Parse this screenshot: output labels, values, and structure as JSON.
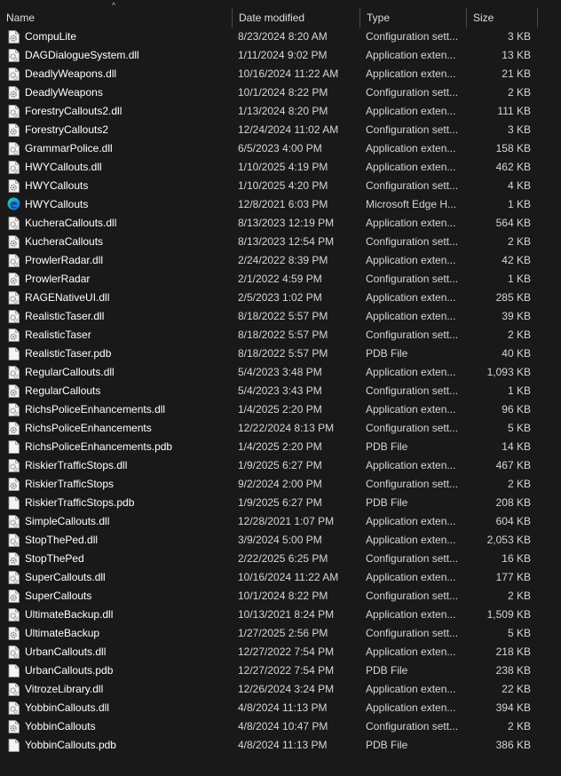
{
  "header": {
    "name": "Name",
    "date": "Date modified",
    "type": "Type",
    "size": "Size",
    "sort_arrow": "^"
  },
  "files": [
    {
      "name": "CompuLite",
      "date": "8/23/2024 8:20 AM",
      "type": "Configuration sett...",
      "size": "3 KB",
      "icon": "config-file-icon"
    },
    {
      "name": "DAGDialogueSystem.dll",
      "date": "1/11/2024 9:02 PM",
      "type": "Application exten...",
      "size": "13 KB",
      "icon": "dll-file-icon"
    },
    {
      "name": "DeadlyWeapons.dll",
      "date": "10/16/2024 11:22 AM",
      "type": "Application exten...",
      "size": "21 KB",
      "icon": "dll-file-icon"
    },
    {
      "name": "DeadlyWeapons",
      "date": "10/1/2024 8:22 PM",
      "type": "Configuration sett...",
      "size": "2 KB",
      "icon": "config-file-icon"
    },
    {
      "name": "ForestryCallouts2.dll",
      "date": "1/13/2024 8:20 PM",
      "type": "Application exten...",
      "size": "111 KB",
      "icon": "dll-file-icon"
    },
    {
      "name": "ForestryCallouts2",
      "date": "12/24/2024 11:02 AM",
      "type": "Configuration sett...",
      "size": "3 KB",
      "icon": "config-file-icon"
    },
    {
      "name": "GrammarPolice.dll",
      "date": "6/5/2023 4:00 PM",
      "type": "Application exten...",
      "size": "158 KB",
      "icon": "dll-file-icon"
    },
    {
      "name": "HWYCallouts.dll",
      "date": "1/10/2025 4:19 PM",
      "type": "Application exten...",
      "size": "462 KB",
      "icon": "dll-file-icon"
    },
    {
      "name": "HWYCallouts",
      "date": "1/10/2025 4:20 PM",
      "type": "Configuration sett...",
      "size": "4 KB",
      "icon": "config-file-icon"
    },
    {
      "name": "HWYCallouts",
      "date": "12/8/2021 6:03 PM",
      "type": "Microsoft Edge H...",
      "size": "1 KB",
      "icon": "edge-icon"
    },
    {
      "name": "KucheraCallouts.dll",
      "date": "8/13/2023 12:19 PM",
      "type": "Application exten...",
      "size": "564 KB",
      "icon": "dll-file-icon"
    },
    {
      "name": "KucheraCallouts",
      "date": "8/13/2023 12:54 PM",
      "type": "Configuration sett...",
      "size": "2 KB",
      "icon": "config-file-icon"
    },
    {
      "name": "ProwlerRadar.dll",
      "date": "2/24/2022 8:39 PM",
      "type": "Application exten...",
      "size": "42 KB",
      "icon": "dll-file-icon"
    },
    {
      "name": "ProwlerRadar",
      "date": "2/1/2022 4:59 PM",
      "type": "Configuration sett...",
      "size": "1 KB",
      "icon": "config-file-icon"
    },
    {
      "name": "RAGENativeUI.dll",
      "date": "2/5/2023 1:02 PM",
      "type": "Application exten...",
      "size": "285 KB",
      "icon": "dll-file-icon"
    },
    {
      "name": "RealisticTaser.dll",
      "date": "8/18/2022 5:57 PM",
      "type": "Application exten...",
      "size": "39 KB",
      "icon": "dll-file-icon"
    },
    {
      "name": "RealisticTaser",
      "date": "8/18/2022 5:57 PM",
      "type": "Configuration sett...",
      "size": "2 KB",
      "icon": "config-file-icon"
    },
    {
      "name": "RealisticTaser.pdb",
      "date": "8/18/2022 5:57 PM",
      "type": "PDB File",
      "size": "40 KB",
      "icon": "blank-file-icon"
    },
    {
      "name": "RegularCallouts.dll",
      "date": "5/4/2023 3:48 PM",
      "type": "Application exten...",
      "size": "1,093 KB",
      "icon": "dll-file-icon"
    },
    {
      "name": "RegularCallouts",
      "date": "5/4/2023 3:43 PM",
      "type": "Configuration sett...",
      "size": "1 KB",
      "icon": "config-file-icon"
    },
    {
      "name": "RichsPoliceEnhancements.dll",
      "date": "1/4/2025 2:20 PM",
      "type": "Application exten...",
      "size": "96 KB",
      "icon": "dll-file-icon"
    },
    {
      "name": "RichsPoliceEnhancements",
      "date": "12/22/2024 8:13 PM",
      "type": "Configuration sett...",
      "size": "5 KB",
      "icon": "config-file-icon"
    },
    {
      "name": "RichsPoliceEnhancements.pdb",
      "date": "1/4/2025 2:20 PM",
      "type": "PDB File",
      "size": "14 KB",
      "icon": "blank-file-icon"
    },
    {
      "name": "RiskierTrafficStops.dll",
      "date": "1/9/2025 6:27 PM",
      "type": "Application exten...",
      "size": "467 KB",
      "icon": "dll-file-icon"
    },
    {
      "name": "RiskierTrafficStops",
      "date": "9/2/2024 2:00 PM",
      "type": "Configuration sett...",
      "size": "2 KB",
      "icon": "config-file-icon"
    },
    {
      "name": "RiskierTrafficStops.pdb",
      "date": "1/9/2025 6:27 PM",
      "type": "PDB File",
      "size": "208 KB",
      "icon": "blank-file-icon"
    },
    {
      "name": "SimpleCallouts.dll",
      "date": "12/28/2021 1:07 PM",
      "type": "Application exten...",
      "size": "604 KB",
      "icon": "dll-file-icon"
    },
    {
      "name": "StopThePed.dll",
      "date": "3/9/2024 5:00 PM",
      "type": "Application exten...",
      "size": "2,053 KB",
      "icon": "dll-file-icon"
    },
    {
      "name": "StopThePed",
      "date": "2/22/2025 6:25 PM",
      "type": "Configuration sett...",
      "size": "16 KB",
      "icon": "config-file-icon"
    },
    {
      "name": "SuperCallouts.dll",
      "date": "10/16/2024 11:22 AM",
      "type": "Application exten...",
      "size": "177 KB",
      "icon": "dll-file-icon"
    },
    {
      "name": "SuperCallouts",
      "date": "10/1/2024 8:22 PM",
      "type": "Configuration sett...",
      "size": "2 KB",
      "icon": "config-file-icon"
    },
    {
      "name": "UltimateBackup.dll",
      "date": "10/13/2021 8:24 PM",
      "type": "Application exten...",
      "size": "1,509 KB",
      "icon": "dll-file-icon"
    },
    {
      "name": "UltimateBackup",
      "date": "1/27/2025 2:56 PM",
      "type": "Configuration sett...",
      "size": "5 KB",
      "icon": "config-file-icon"
    },
    {
      "name": "UrbanCallouts.dll",
      "date": "12/27/2022 7:54 PM",
      "type": "Application exten...",
      "size": "218 KB",
      "icon": "dll-file-icon"
    },
    {
      "name": "UrbanCallouts.pdb",
      "date": "12/27/2022 7:54 PM",
      "type": "PDB File",
      "size": "238 KB",
      "icon": "blank-file-icon"
    },
    {
      "name": "VitrozeLibrary.dll",
      "date": "12/26/2024 3:24 PM",
      "type": "Application exten...",
      "size": "22 KB",
      "icon": "dll-file-icon"
    },
    {
      "name": "YobbinCallouts.dll",
      "date": "4/8/2024 11:13 PM",
      "type": "Application exten...",
      "size": "394 KB",
      "icon": "dll-file-icon"
    },
    {
      "name": "YobbinCallouts",
      "date": "4/8/2024 10:47 PM",
      "type": "Configuration sett...",
      "size": "2 KB",
      "icon": "config-file-icon"
    },
    {
      "name": "YobbinCallouts.pdb",
      "date": "4/8/2024 11:13 PM",
      "type": "PDB File",
      "size": "386 KB",
      "icon": "blank-file-icon"
    }
  ]
}
